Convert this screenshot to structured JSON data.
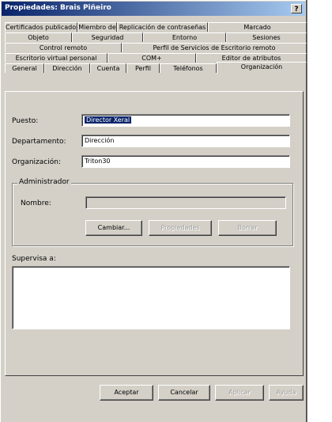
{
  "window": {
    "title": "Propiedades: Brais Piñeiro",
    "help_label": "?"
  },
  "tabs": {
    "row1": [
      "Certificados publicados",
      "Miembro de",
      "Replicación de contraseñas",
      "Marcado"
    ],
    "row2": [
      "Objeto",
      "Seguridad",
      "Entorno",
      "Sesiones"
    ],
    "row3": [
      "Control remoto",
      "Perfil de Servicios de Escritorio remoto"
    ],
    "row4": [
      "Escritorio virtual personal",
      "COM+",
      "Editor de atributos"
    ],
    "row5": [
      "General",
      "Dirección",
      "Cuenta",
      "Perfil",
      "Teléfonos",
      "Organización"
    ],
    "active": "Organización"
  },
  "form": {
    "puesto_label": "Puesto:",
    "puesto_value": "Director Xeral",
    "departamento_label": "Departamento:",
    "departamento_value": "Dirección",
    "organizacion_label": "Organización:",
    "organizacion_value": "Triton30",
    "administrador_legend": "Administrador",
    "nombre_label": "Nombre:",
    "nombre_value": "",
    "cambiar_label": "Cambiar...",
    "propiedades_label": "Propiedades",
    "borrar_label": "Borrar",
    "supervisa_label": "Supervisa a:"
  },
  "footer": {
    "aceptar_label": "Aceptar",
    "cancelar_label": "Cancelar",
    "aplicar_label": "Aplicar",
    "ayuda_label": "Ayuda"
  }
}
